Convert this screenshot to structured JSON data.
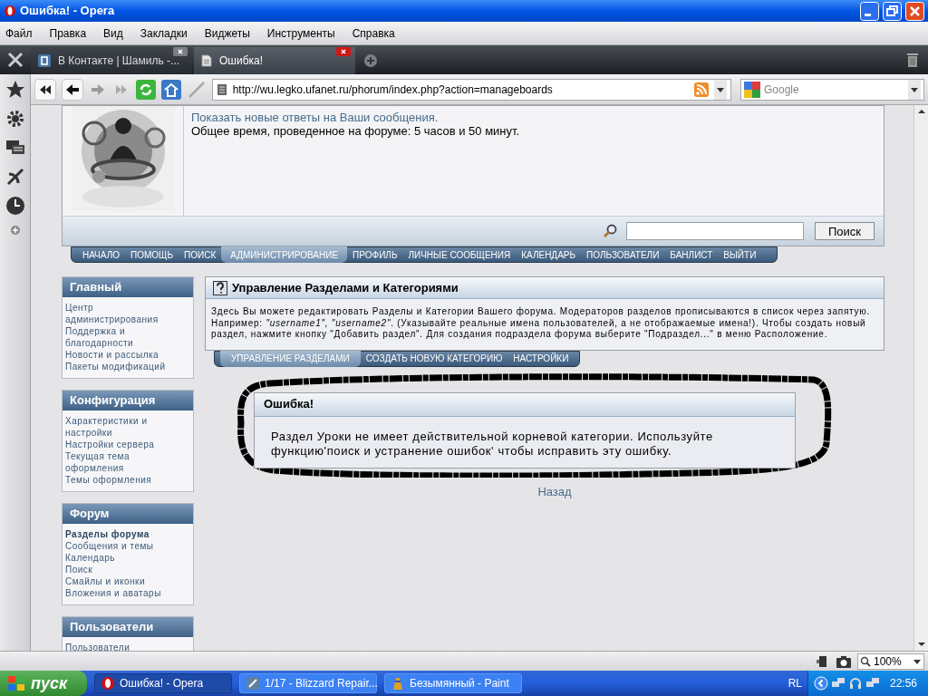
{
  "window": {
    "title": "Ошибка! - Opera"
  },
  "menu": [
    "Файл",
    "Правка",
    "Вид",
    "Закладки",
    "Виджеты",
    "Инструменты",
    "Справка"
  ],
  "tabs": [
    {
      "label": "В Контакте | Шамиль -...",
      "selected": false
    },
    {
      "label": "Ошибка!",
      "selected": true
    }
  ],
  "address": {
    "url": "http://wu.legko.ufanet.ru/phorum/index.php?action=manageboards"
  },
  "search": {
    "placeholder": "Google"
  },
  "profile": {
    "lines": [
      {
        "kind": "link",
        "text": "Показать новые ответы на Ваши сообщения."
      },
      {
        "kind": "plain",
        "text": "Общее время, проведенное на форуме: 5 часов и 50 минут."
      }
    ]
  },
  "forum_search": {
    "button": "Поиск"
  },
  "nav": [
    {
      "label": "НАЧАЛО",
      "selected": false
    },
    {
      "label": "ПОМОЩЬ",
      "selected": false
    },
    {
      "label": "ПОИСК",
      "selected": false
    },
    {
      "label": "АДМИНИСТРИРОВАНИЕ",
      "selected": true
    },
    {
      "label": "ПРОФИЛЬ",
      "selected": false
    },
    {
      "label": "ЛИЧНЫЕ СООБЩЕНИЯ",
      "selected": false
    },
    {
      "label": "КАЛЕНДАРЬ",
      "selected": false
    },
    {
      "label": "ПОЛЬЗОВАТЕЛИ",
      "selected": false
    },
    {
      "label": "БАНЛИСТ",
      "selected": false
    },
    {
      "label": "ВЫЙТИ",
      "selected": false
    }
  ],
  "sidebar": {
    "sections": [
      {
        "title": "Главный",
        "items": [
          {
            "label": "Центр администрирования",
            "selected": false
          },
          {
            "label": "Поддержка и благодарности",
            "selected": false
          },
          {
            "label": "Новости и рассылка",
            "selected": false
          },
          {
            "label": "Пакеты модификаций",
            "selected": false
          }
        ]
      },
      {
        "title": "Конфигурация",
        "items": [
          {
            "label": "Характеристики и настройки",
            "selected": false
          },
          {
            "label": "Настройки сервера",
            "selected": false
          },
          {
            "label": "Текущая тема оформления",
            "selected": false
          },
          {
            "label": "Темы оформления",
            "selected": false
          }
        ]
      },
      {
        "title": "Форум",
        "items": [
          {
            "label": "Разделы форума",
            "selected": true
          },
          {
            "label": "Сообщения и темы",
            "selected": false
          },
          {
            "label": "Календарь",
            "selected": false
          },
          {
            "label": "Поиск",
            "selected": false
          },
          {
            "label": "Смайлы и иконки",
            "selected": false
          },
          {
            "label": "Вложения и аватары",
            "selected": false
          }
        ]
      },
      {
        "title": "Пользователи",
        "items": [
          {
            "label": "Пользователи",
            "selected": false
          }
        ]
      }
    ]
  },
  "manage": {
    "title": "Управление Разделами и Категориями",
    "description": "Здесь Вы можете редактировать Разделы и Категории Вашего форума. Модераторов разделов прописываются в список через запятую. Например: *\"username1\", \"username2\"*. (Указывайте реальные имена пользователей, а не отображаемые имена!). Чтобы создать новый раздел, нажмите кнопку \"Добавить раздел\". Для создания подраздела форума выберите \"Подраздел...\" в меню Расположение.",
    "tabs": [
      {
        "label": "УПРАВЛЕНИЕ РАЗДЕЛАМИ",
        "selected": true
      },
      {
        "label": "СОЗДАТЬ НОВУЮ КАТЕГОРИЮ",
        "selected": false
      },
      {
        "label": "НАСТРОЙКИ",
        "selected": false
      }
    ]
  },
  "error": {
    "title": "Ошибка!",
    "message": "Раздел Уроки не имеет действительной корневой категории. Используйте функцию'поиск и устранение ошибок' чтобы исправить эту ошибку."
  },
  "back_link": "Назад",
  "status_bar": {
    "zoom": "100%"
  },
  "taskbar": {
    "start": "пуск",
    "tasks": [
      {
        "label": "Ошибка! - Opera",
        "selected": true
      },
      {
        "label": "1/17 - Blizzard Repair...",
        "selected": false
      },
      {
        "label": "Безымянный - Paint",
        "selected": false
      }
    ],
    "tray": {
      "language": "RL",
      "time": "22:56"
    }
  }
}
